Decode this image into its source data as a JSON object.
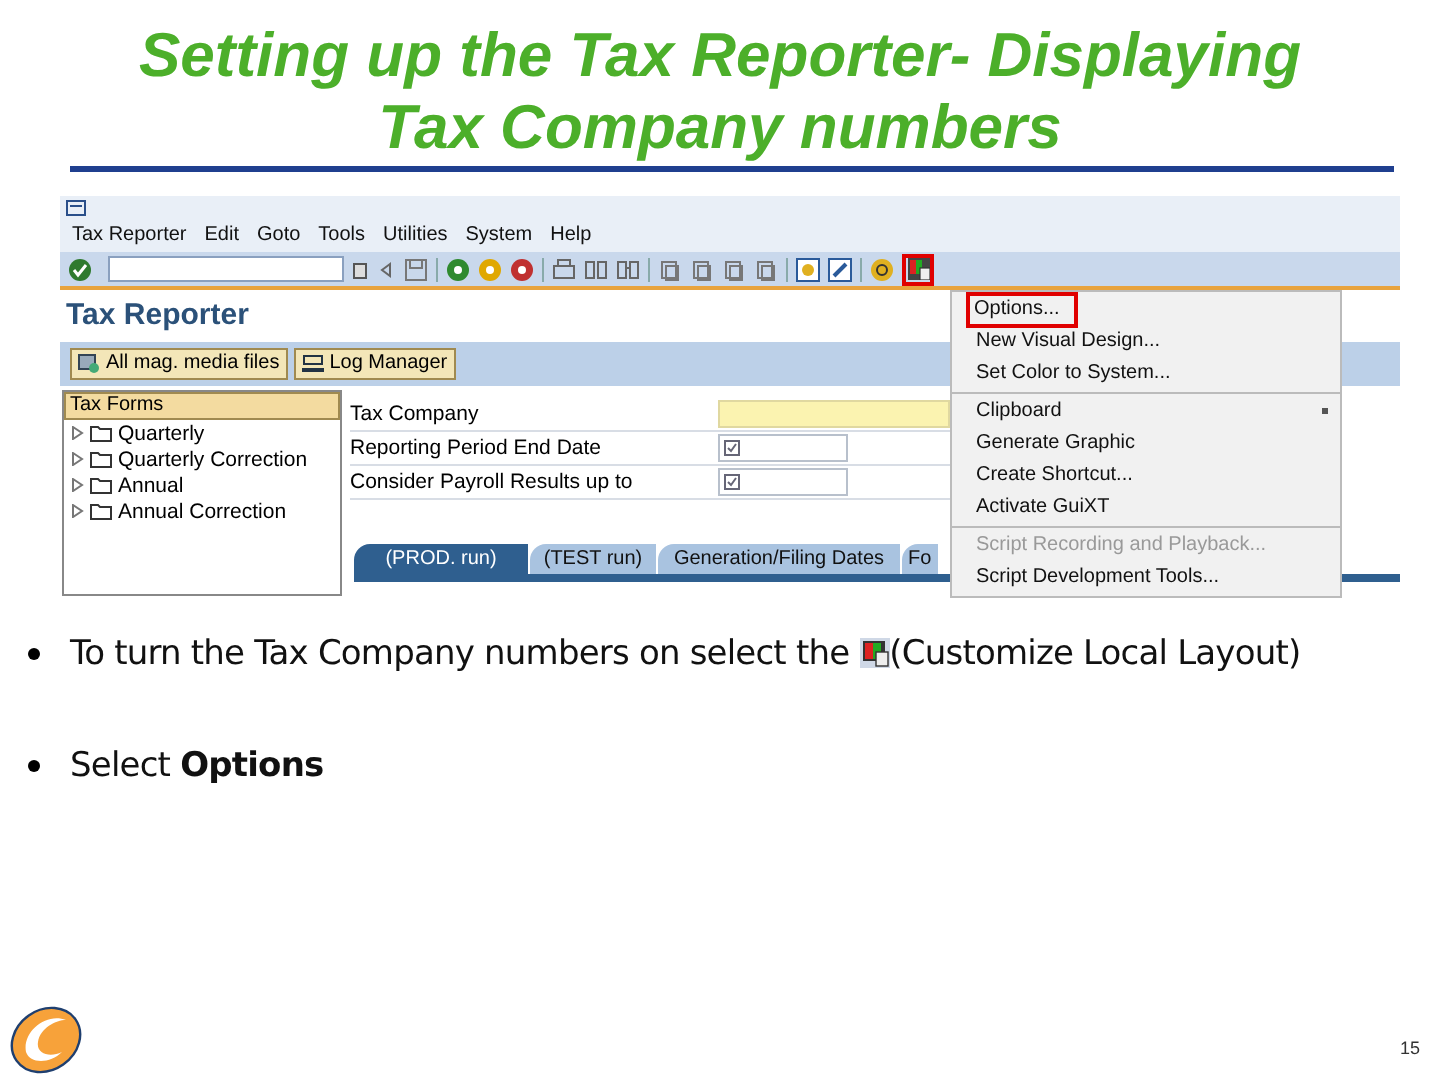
{
  "slide_title": "Setting up the Tax Reporter- Displaying Tax Company numbers",
  "sap_window": {
    "menu_bar": [
      "Tax Reporter",
      "Edit",
      "Goto",
      "Tools",
      "Utilities",
      "System",
      "Help"
    ],
    "layout_button": {
      "highlighted": true
    },
    "screen_title": "Tax Reporter",
    "app_buttons": [
      "All mag. media files",
      "Log Manager"
    ],
    "tree": {
      "title": "Tax Forms",
      "items": [
        {
          "label": "Quarterly",
          "expanded": false
        },
        {
          "label": "Quarterly Correction",
          "expanded": false
        },
        {
          "label": "Annual",
          "expanded": false
        },
        {
          "label": "Annual Correction",
          "expanded": false
        }
      ]
    },
    "form": [
      {
        "label": "Tax Company",
        "kind": "highlight"
      },
      {
        "label": "Reporting Period End Date",
        "kind": "required"
      },
      {
        "label": "Consider Payroll Results up to",
        "kind": "required"
      }
    ],
    "tabs": [
      {
        "label": "(PROD. run)",
        "selected": true
      },
      {
        "label": "(TEST run)",
        "selected": false
      },
      {
        "label": "Generation/Filing Dates",
        "selected": false
      },
      {
        "label": "Fo",
        "selected": false
      }
    ],
    "layout_menu": [
      [
        {
          "label": "Options...",
          "highlighted": true,
          "disabled": false,
          "submenu": false
        },
        {
          "label": "New Visual Design...",
          "highlighted": false,
          "disabled": false,
          "submenu": false
        },
        {
          "label": "Set Color to System...",
          "highlighted": false,
          "disabled": false,
          "submenu": false
        }
      ],
      [
        {
          "label": "Clipboard",
          "highlighted": false,
          "disabled": false,
          "submenu": true
        },
        {
          "label": "Generate Graphic",
          "highlighted": false,
          "disabled": false,
          "submenu": false
        },
        {
          "label": "Create Shortcut...",
          "highlighted": false,
          "disabled": false,
          "submenu": false
        },
        {
          "label": "Activate GuiXT",
          "highlighted": false,
          "disabled": false,
          "submenu": false
        }
      ],
      [
        {
          "label": "Script Recording and Playback...",
          "highlighted": false,
          "disabled": true,
          "submenu": false
        },
        {
          "label": "Script Development Tools...",
          "highlighted": false,
          "disabled": false,
          "submenu": false
        }
      ]
    ]
  },
  "bullets": [
    {
      "kind": "icon_inline",
      "before": "To turn the Tax Company numbers on select the",
      "after": "(Customize Local Layout)"
    },
    {
      "kind": "text",
      "text": "Select **Options**"
    }
  ],
  "page_number": "15"
}
